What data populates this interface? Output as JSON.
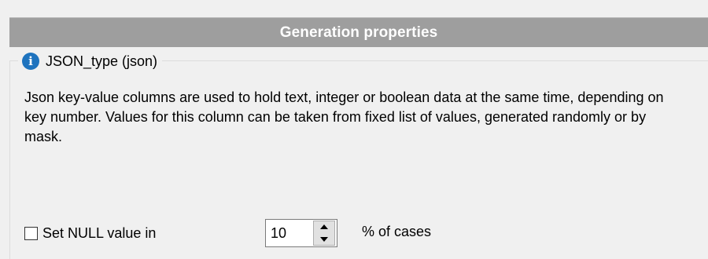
{
  "header": {
    "title": "Generation properties"
  },
  "group": {
    "icon": "info-icon",
    "icon_glyph": "i",
    "legend": "JSON_type (json)"
  },
  "description": "Json key-value columns are used to hold text, integer or boolean data at the same time, depending on key number. Values for this column can be taken from fixed list of values, generated randomly or by mask.",
  "null_option": {
    "checked": false,
    "label": "Set NULL value in",
    "value": "10",
    "suffix": "% of cases"
  },
  "colors": {
    "header_bg": "#9e9e9e",
    "header_text": "#ffffff",
    "panel_bg": "#f0f0f0",
    "info_icon": "#1e73be"
  }
}
